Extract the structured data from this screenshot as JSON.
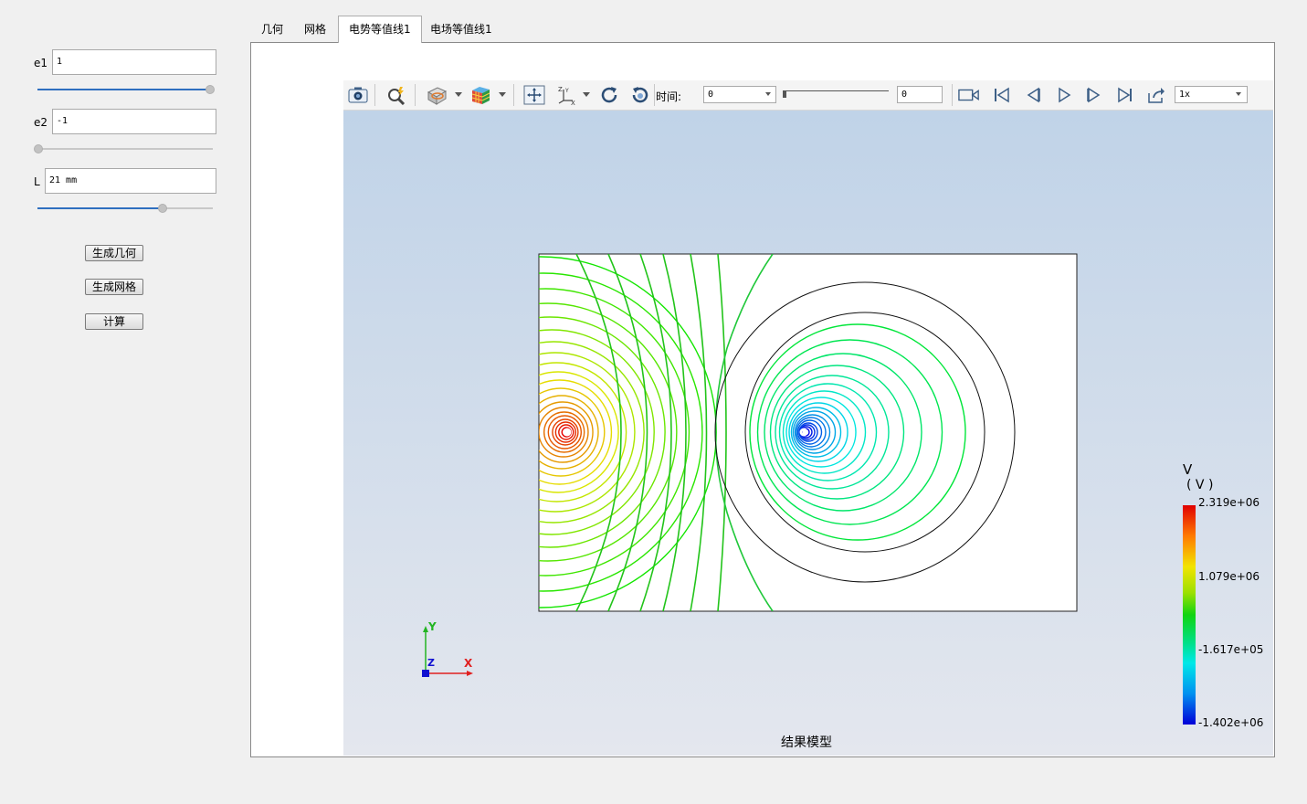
{
  "params": [
    {
      "label": "e1",
      "value": "1",
      "slider": 1.0
    },
    {
      "label": "e2",
      "value": "-1",
      "slider": 0.0
    },
    {
      "label": "L",
      "value": "21 mm",
      "slider": 0.7
    }
  ],
  "buttons": {
    "geometry": "生成几何",
    "mesh": "生成网格",
    "compute": "计算"
  },
  "tabs": [
    "几何",
    "网格",
    "电势等值线1",
    "电场等值线1"
  ],
  "active_tab": 2,
  "toolbar": {
    "time_label": "时间:",
    "time_value": "0",
    "frame_value": "0",
    "speed_value": "1x",
    "icons": [
      "camera-icon",
      "zoom-icon",
      "clip-plane-icon",
      "color-cube-icon",
      "fit-view-icon",
      "axes-icon",
      "rotate-icon",
      "reset-view-icon",
      "record-icon",
      "first-frame-icon",
      "step-back-icon",
      "play-icon",
      "step-forward-icon",
      "last-frame-icon",
      "export-icon"
    ]
  },
  "viewport": {
    "title": "结果模型",
    "axes": {
      "x": "X",
      "y": "Y",
      "z": "Z"
    },
    "legend": {
      "title": "V",
      "unit": "( V )",
      "ticks": [
        "2.319e+06",
        "1.079e+06",
        "-1.617e+05",
        "-1.402e+06"
      ]
    }
  }
}
